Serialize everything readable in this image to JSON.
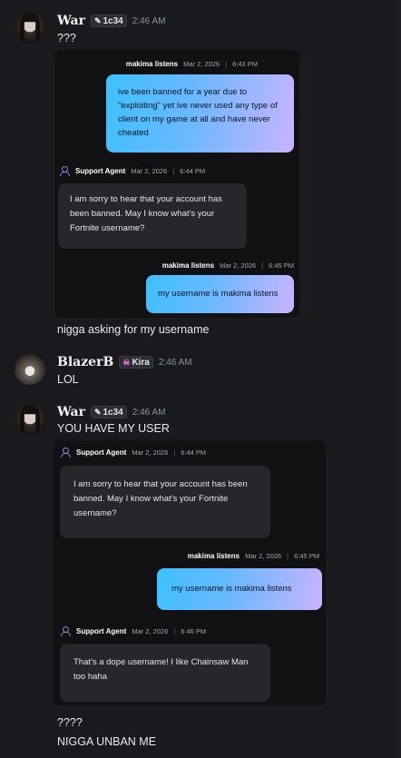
{
  "messages": [
    {
      "username": "War",
      "tag": "1c34",
      "tag_icon": "feather-icon",
      "time": "2:46 AM",
      "text": "???",
      "card": {
        "items": [
          {
            "sender": "makima listens",
            "date": "Mar 2, 2026",
            "time": "6:43 PM",
            "text": "ive been banned for a year due to \"exploiting\" yet ive never used any type of client on my game at all and have never cheated"
          },
          {
            "sender": "Support Agent",
            "date": "Mar 2, 2026",
            "time": "6:44 PM",
            "text": "I am sorry to hear that your account has been banned. May I know what's your Fortnite username?"
          },
          {
            "sender": "makima listens",
            "date": "Mar 2, 2026",
            "time": "6:45 PM",
            "text": "my username is makima listens"
          }
        ]
      },
      "after_text": "nigga asking for my username"
    },
    {
      "username": "BlazerB",
      "tag": "Kira",
      "tag_icon": "skull-icon",
      "time": "2:46 AM",
      "text": "LOL"
    },
    {
      "username": "War",
      "tag": "1c34",
      "tag_icon": "feather-icon",
      "time": "2:46 AM",
      "text": "YOU HAVE MY USER",
      "card": {
        "items": [
          {
            "sender": "Support Agent",
            "date": "Mar 2, 2026",
            "time": "6:44 PM",
            "text": "I am sorry to hear that your account has been banned. May I know what's your Fortnite username?"
          },
          {
            "sender": "makima listens",
            "date": "Mar 2, 2026",
            "time": "6:45 PM",
            "text": "my username is makima listens"
          },
          {
            "sender": "Support Agent",
            "date": "Mar 2, 2026",
            "time": "6:46 PM",
            "text": "That's a dope username! I like Chainsaw Man too haha"
          }
        ]
      },
      "after_text": [
        "????",
        "NIGGA UNBAN ME"
      ]
    }
  ],
  "colors": {
    "background": "#1a1a1e",
    "card": "#111114",
    "user_bubble_gradient": [
      "#3ec0ff",
      "#c8b4ff"
    ],
    "agent_bubble": "#26262b",
    "agent_icon": "#9b7fd0"
  },
  "meta_separator": "|"
}
